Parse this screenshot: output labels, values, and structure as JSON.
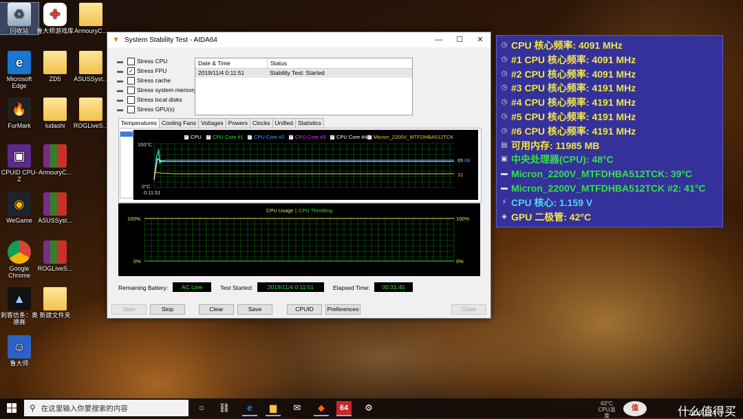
{
  "desktop_icons": [
    {
      "label": "回收站",
      "icon": "recycle-bin-icon"
    },
    {
      "label": "鲁大师游戏库",
      "icon": "gamepad-icon"
    },
    {
      "label": "ArmouryC...",
      "icon": "folder-icon"
    },
    {
      "label": "Microsoft Edge",
      "icon": "edge-icon"
    },
    {
      "label": "ZD5",
      "icon": "folder-icon"
    },
    {
      "label": "ASUSSyst...",
      "icon": "folder-icon"
    },
    {
      "label": "FurMark",
      "icon": "furmark-icon"
    },
    {
      "label": "ludashi",
      "icon": "folder-icon"
    },
    {
      "label": "ROGLiveS...",
      "icon": "folder-icon"
    },
    {
      "label": "CPUID CPU-Z",
      "icon": "cpuz-icon"
    },
    {
      "label": "ArmouryC...",
      "icon": "winrar-icon"
    },
    {
      "label": "WeGame",
      "icon": "wegame-icon"
    },
    {
      "label": "ASUSSyst...",
      "icon": "winrar-icon"
    },
    {
      "label": "Google Chrome",
      "icon": "chrome-icon"
    },
    {
      "label": "ROGLiveS...",
      "icon": "winrar-icon"
    },
    {
      "label": "刺客信条：奥德赛",
      "icon": "game-icon"
    },
    {
      "label": "新建文件夹",
      "icon": "folder-icon"
    },
    {
      "label": "鲁大师",
      "icon": "ludashi-icon"
    }
  ],
  "window": {
    "title": "System Stability Test - AIDA64",
    "stress_options": [
      {
        "label": "Stress CPU",
        "checked": false
      },
      {
        "label": "Stress FPU",
        "checked": true
      },
      {
        "label": "Stress cache",
        "checked": false
      },
      {
        "label": "Stress system memory",
        "checked": false
      },
      {
        "label": "Stress local disks",
        "checked": false
      },
      {
        "label": "Stress GPU(s)",
        "checked": false
      }
    ],
    "log": {
      "col_date": "Date & Time",
      "col_status": "Status",
      "rows": [
        {
          "date": "2019/11/4 0:11:51",
          "status": "Stability Test: Started"
        }
      ]
    },
    "tabs": [
      "Temperatures",
      "Cooling Fans",
      "Voltages",
      "Powers",
      "Clocks",
      "Unified",
      "Statistics"
    ],
    "temp_graph": {
      "legend": [
        {
          "label": "CPU",
          "color": "#ffffff"
        },
        {
          "label": "CPU Core #1",
          "color": "#2ee62e"
        },
        {
          "label": "CPU Core #2",
          "color": "#3fa9ff"
        },
        {
          "label": "CPU Core #3",
          "color": "#e040fb"
        },
        {
          "label": "CPU Core #4",
          "color": "#ffffff"
        },
        {
          "label": "Micron_2200V_MTFDHBA512TCK",
          "color": "#e6c84a"
        }
      ],
      "y_top": "100°C",
      "y_bottom": "0°C",
      "x_start": "0:11:51",
      "right_val_1": "65",
      "right_val_1b": "68",
      "right_val_2": "31"
    },
    "usage_graph": {
      "legend_usage": "CPU Usage",
      "legend_sep": "|",
      "legend_throttle": "CPU Throttling",
      "left_top": "100%",
      "left_bottom": "0%",
      "right_top": "100%",
      "right_bottom": "0%"
    },
    "status": {
      "battery_label": "Remaining Battery:",
      "battery_value": "AC Line",
      "started_label": "Test Started:",
      "started_value": "2019/11/4 0:11:51",
      "elapsed_label": "Elapsed Time:",
      "elapsed_value": "00:31:45"
    },
    "buttons": {
      "start": "Start",
      "stop": "Stop",
      "clear": "Clear",
      "save": "Save",
      "cpuid": "CPUID",
      "preferences": "Preferences",
      "close": "Close"
    }
  },
  "osd": [
    {
      "text": "CPU 核心频率: 4091 MHz",
      "color": "#f5e642",
      "icon": "clock-icon"
    },
    {
      "text": "#1 CPU 核心频率: 4091 MHz",
      "color": "#f5e642",
      "icon": "clock-icon"
    },
    {
      "text": "#2 CPU 核心频率: 4091 MHz",
      "color": "#f5e642",
      "icon": "clock-icon"
    },
    {
      "text": "#3 CPU 核心频率: 4191 MHz",
      "color": "#f5e642",
      "icon": "clock-icon"
    },
    {
      "text": "#4 CPU 核心频率: 4191 MHz",
      "color": "#f5e642",
      "icon": "clock-icon"
    },
    {
      "text": "#5 CPU 核心频率: 4191 MHz",
      "color": "#f5e642",
      "icon": "clock-icon"
    },
    {
      "text": "#6 CPU 核心频率: 4191 MHz",
      "color": "#f5e642",
      "icon": "clock-icon"
    },
    {
      "text": "可用内存: 11985 MB",
      "color": "#f5e642",
      "icon": "memory-icon"
    },
    {
      "text": "中央处理器(CPU): 48°C",
      "color": "#35e04a",
      "icon": "cpu-icon"
    },
    {
      "text": "Micron_2200V_MTFDHBA512TCK: 39°C",
      "color": "#35e04a",
      "icon": "disk-icon"
    },
    {
      "text": "Micron_2200V_MTFDHBA512TCK #2: 41°C",
      "color": "#35e04a",
      "icon": "disk-icon"
    },
    {
      "text": "CPU 核心: 1.159 V",
      "color": "#4fd6f5",
      "icon": "voltage-icon"
    },
    {
      "text": "GPU 二极管: 42°C",
      "color": "#f5e642",
      "icon": "gpu-icon"
    }
  ],
  "taskbar": {
    "search_placeholder": "在这里输入你要搜索的内容",
    "apps": [
      "task-view-icon",
      "game-icon",
      "edge-icon",
      "file-explorer-icon",
      "mail-icon",
      "game-icon",
      "aida64-icon",
      "settings-icon"
    ],
    "aida_label": "64",
    "cpu_temp": "63°C",
    "cpu_temp_label": "CPU温度",
    "watermark": "什么值得买",
    "date": "2019/11/4"
  },
  "colors": {
    "osd_bg": "#34329a",
    "graph_bg": "#000000",
    "grid": "#0f6f0f",
    "accent": "#3b7ad9"
  }
}
